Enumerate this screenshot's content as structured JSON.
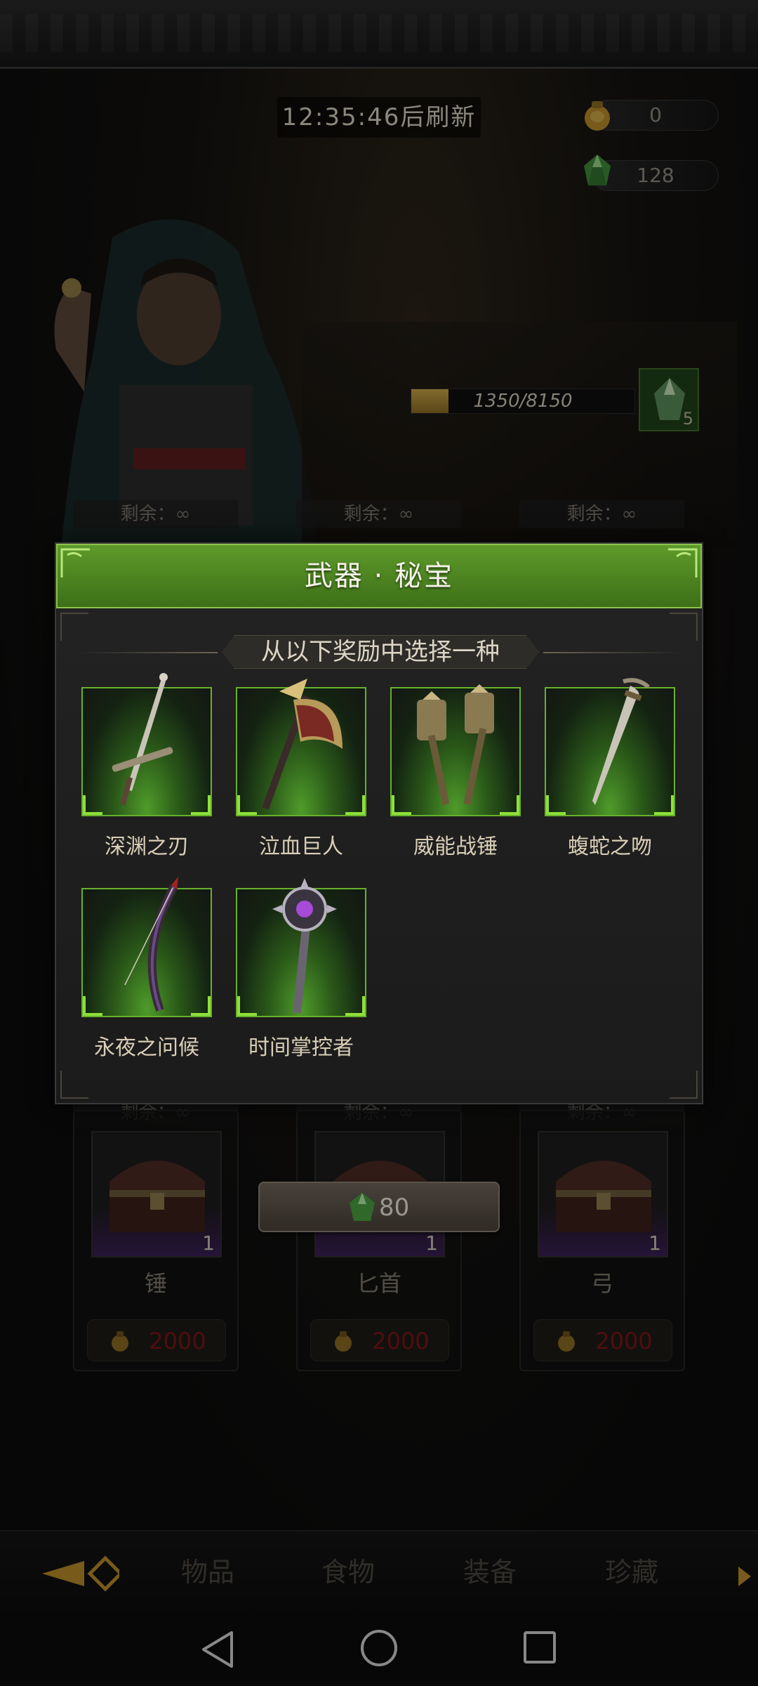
{
  "header": {
    "refresh_timer": "12:35:46后刷新"
  },
  "currencies": [
    {
      "icon": "gold-pouch-icon",
      "value": "0"
    },
    {
      "icon": "green-gem-icon",
      "value": "128"
    }
  ],
  "progress": {
    "text": "1350/8150",
    "current": 1350,
    "max": 8150,
    "gem_slot_count": "5"
  },
  "remaining_label": "剩余：∞",
  "shop": {
    "cards": [
      {
        "name": "锤",
        "count": "1",
        "price": "2000"
      },
      {
        "name": "匕首",
        "count": "1",
        "price": "2000"
      },
      {
        "name": "弓",
        "count": "1",
        "price": "2000"
      }
    ],
    "buy_button": {
      "cost": "80",
      "icon": "green-gem-icon"
    }
  },
  "tabs": [
    {
      "label": "物品"
    },
    {
      "label": "食物"
    },
    {
      "label": "装备"
    },
    {
      "label": "珍藏"
    }
  ],
  "dialog": {
    "title": "武器 · 秘宝",
    "subtitle": "从以下奖励中选择一种",
    "rewards": [
      {
        "name": "深渊之刃",
        "icon": "sword-icon"
      },
      {
        "name": "泣血巨人",
        "icon": "axe-icon"
      },
      {
        "name": "威能战锤",
        "icon": "war-hammer-icon"
      },
      {
        "name": "蝮蛇之吻",
        "icon": "dagger-icon"
      },
      {
        "name": "永夜之问候",
        "icon": "bow-icon"
      },
      {
        "name": "时间掌控者",
        "icon": "scepter-icon"
      }
    ]
  },
  "colors": {
    "accent_green": "#5e9a2a",
    "price_red": "#7a1616",
    "gold": "#c9a548"
  }
}
